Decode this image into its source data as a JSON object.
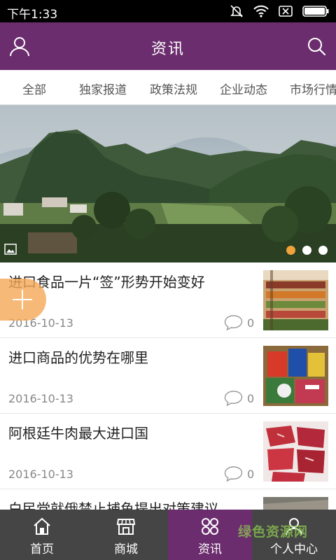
{
  "status_bar": {
    "time": "下午1:33"
  },
  "app_bar": {
    "title": "资讯"
  },
  "tabs": [
    "全部",
    "独家报道",
    "政策法规",
    "企业动态",
    "市场行情"
  ],
  "banner": {
    "slide_count": 3,
    "active_slide": 1
  },
  "articles": [
    {
      "title": "进口食品一片“签”形势开始变好",
      "date": "2016-10-13",
      "comments": "0",
      "thumb": "supermarket-shelves"
    },
    {
      "title": "进口商品的优势在哪里",
      "date": "2016-10-13",
      "comments": "0",
      "thumb": "imported-snacks"
    },
    {
      "title": "阿根廷牛肉最大进口国",
      "date": "2016-10-13",
      "comments": "0",
      "thumb": "raw-beef"
    },
    {
      "title": "白民党就俄禁止捕鱼提出对策建议",
      "date": "",
      "comments": "",
      "thumb": "fish"
    }
  ],
  "bottom_nav": [
    {
      "label": "首页",
      "icon": "home-icon"
    },
    {
      "label": "商城",
      "icon": "store-icon"
    },
    {
      "label": "资讯",
      "icon": "news-grid-icon",
      "active": true
    },
    {
      "label": "个人中心",
      "icon": "person-icon"
    }
  ],
  "watermark": "绿色资源网",
  "colors": {
    "primary": "#6b2d6e",
    "nav_bg": "#454545",
    "accent": "#f0a33a"
  }
}
